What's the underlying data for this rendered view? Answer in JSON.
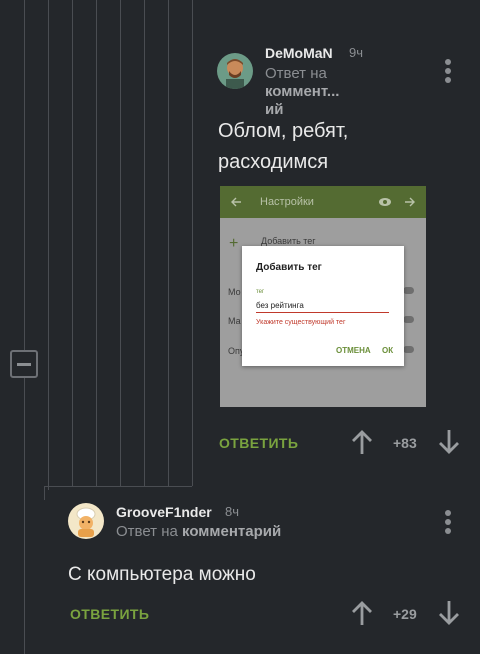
{
  "comments": [
    {
      "username": "DeMoMaN",
      "time": "9ч",
      "reply_prefix": "Ответ на",
      "reply_target_1": "коммент...",
      "reply_target_2": "ий",
      "text_line1": "Облом, ребят,",
      "text_line2": "расходимся",
      "reply_label": "ОТВЕТИТЬ",
      "score": "+83"
    },
    {
      "username": "GrooveF1nder",
      "time": "8ч",
      "reply_prefix": "Ответ на",
      "reply_target": "комментарий",
      "text": "С компьютера можно",
      "reply_label": "ОТВЕТИТЬ",
      "score": "+29"
    }
  ],
  "embedded_screenshot": {
    "toolbar_title": "Настройки",
    "add_tag_row": "Добавить тег",
    "row_mo": "Мо",
    "row_ma": "Ма",
    "row_opu": "Опу",
    "dialog": {
      "title": "Добавить тег",
      "field_label": "тег",
      "field_value": "без рейтинга",
      "error": "Укажите существующий тег",
      "cancel": "ОТМЕНА",
      "ok": "ОК"
    }
  },
  "colors": {
    "background": "#24272b",
    "accent_green": "#7aa33f",
    "muted_text": "#8b8e92"
  }
}
